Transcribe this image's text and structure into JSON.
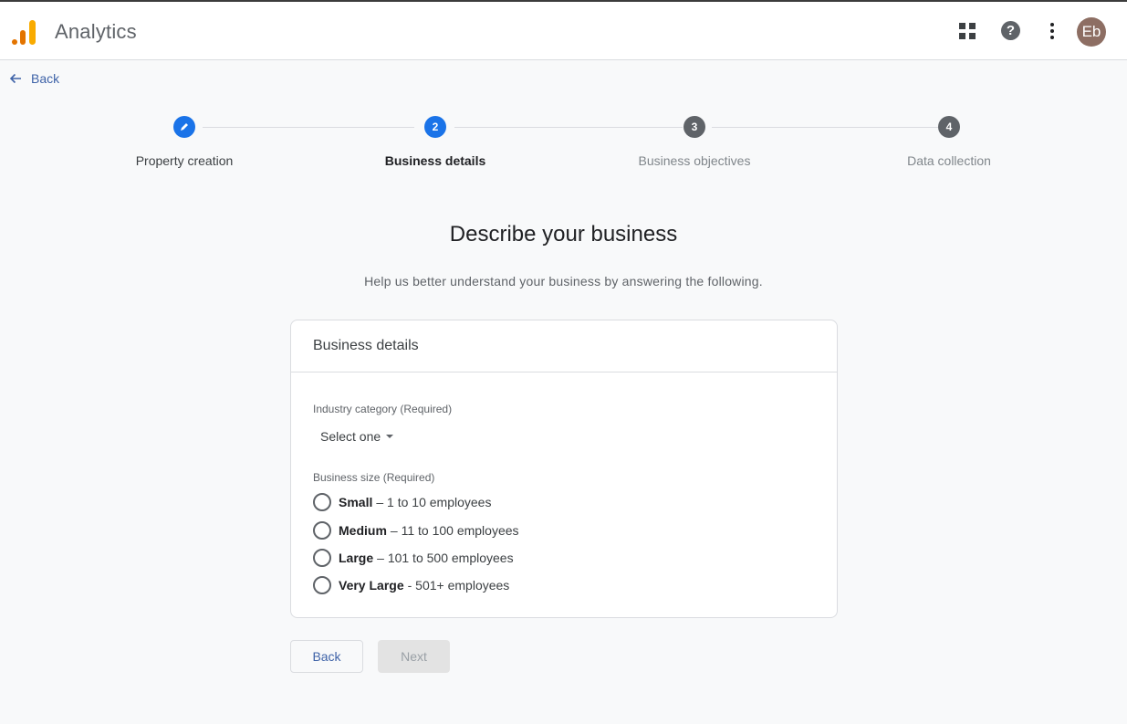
{
  "header": {
    "app_title": "Analytics",
    "icons": [
      "apps-icon",
      "help-icon",
      "more-vert-icon"
    ],
    "avatar_initials": "Eb",
    "avatar_color": "#8d6e63"
  },
  "back_link": {
    "label": "Back"
  },
  "stepper": {
    "steps": [
      {
        "number": "",
        "label": "Property creation",
        "state": "completed",
        "icon": "pencil-icon"
      },
      {
        "number": "2",
        "label": "Business details",
        "state": "current"
      },
      {
        "number": "3",
        "label": "Business objectives",
        "state": "upcoming"
      },
      {
        "number": "4",
        "label": "Data collection",
        "state": "upcoming"
      }
    ],
    "accent_color": "#1a73e8"
  },
  "main": {
    "heading": "Describe your business",
    "subheading": "Help us better understand your business by answering the following."
  },
  "card": {
    "title": "Business details",
    "industry": {
      "label": "Industry category (Required)",
      "selected": "Select one"
    },
    "business_size": {
      "label": "Business size (Required)",
      "options": [
        {
          "name": "Small",
          "separator": "–",
          "detail": "1 to 10 employees",
          "checked": false
        },
        {
          "name": "Medium",
          "separator": "–",
          "detail": "11 to 100 employees",
          "checked": false
        },
        {
          "name": "Large",
          "separator": "–",
          "detail": "101 to 500 employees",
          "checked": false
        },
        {
          "name": "Very Large",
          "separator": "-",
          "detail": "501+ employees",
          "checked": false
        }
      ]
    }
  },
  "actions": {
    "back_label": "Back",
    "next_label": "Next",
    "next_disabled": true
  }
}
